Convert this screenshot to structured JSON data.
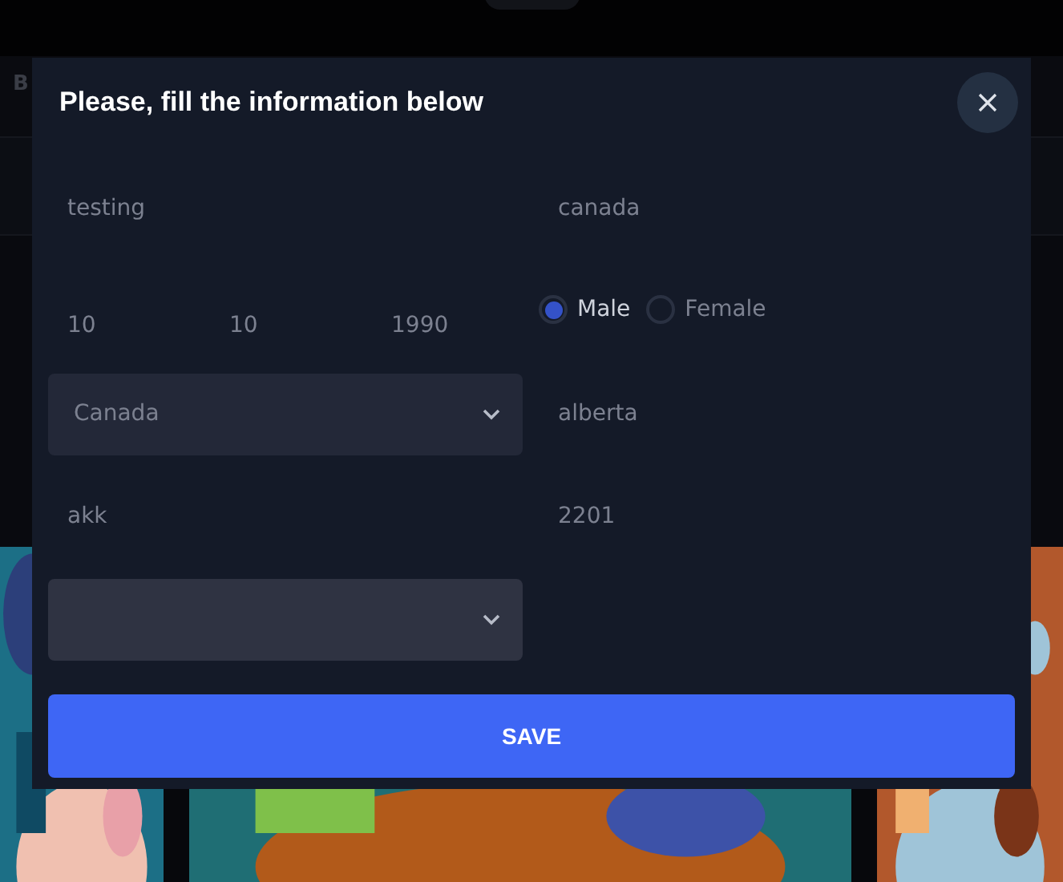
{
  "background": {
    "header_text": "B"
  },
  "modal": {
    "title": "Please, fill the information below",
    "rows": [
      [
        {
          "kind": "text",
          "value": "testing"
        },
        {
          "kind": "text",
          "value": "canada"
        }
      ],
      [
        {
          "kind": "date",
          "parts": [
            "10",
            "10",
            "1990"
          ]
        },
        {
          "kind": "radio",
          "options": [
            {
              "label": "Male",
              "selected": true
            },
            {
              "label": "Female",
              "selected": false
            }
          ]
        }
      ],
      [
        {
          "kind": "select",
          "value": "Canada"
        },
        {
          "kind": "text",
          "value": "alberta"
        }
      ],
      [
        {
          "kind": "text",
          "value": "akk"
        },
        {
          "kind": "text",
          "value": "2201"
        }
      ],
      [
        {
          "kind": "select"
        }
      ]
    ],
    "save_button": "SAVE"
  }
}
